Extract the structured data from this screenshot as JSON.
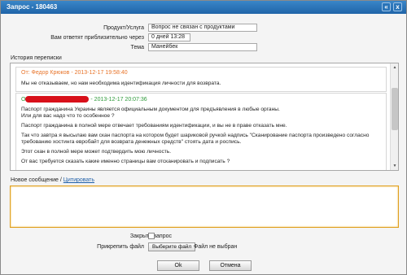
{
  "window": {
    "title": "Запрос - 180463",
    "controls": [
      "«",
      "x"
    ]
  },
  "form": {
    "product_label": "Продукт/Услуга",
    "product_value": "Вопрос не связан с продуктами",
    "eta_label": "Вам ответят приблизительно через",
    "eta_value": "0 дней 13:28",
    "subject_label": "Тема",
    "subject_value": "Манейбек"
  },
  "history": {
    "label": "История переписки",
    "messages": [
      {
        "header": "От: Федор Крюков - 2013-12-17 19:58:40",
        "header_color": "#e8742a",
        "lines": [
          "Мы не отказываем, но нам необходима идентификация личности для возврата."
        ]
      },
      {
        "header_prefix": "О",
        "header_suffix": "- 2013-12-17 20:07:36",
        "header_color": "#2e9a3a",
        "lines": [
          "Паспорт гражданина Украины является официальным документом для предъявления в любые органы.",
          "Или для вас надо что то особенное ?",
          "Паспорт гражданина в полной мере отвечает требованиям идентификации, и вы не в праве отказать мне.",
          "Так что завтра я высылаю вам скан паспорта на котором будет шариковой ручкой надпись \"Сканирование паспорта произведено согласно требованию хостинга евробайт для возврата денежных средств\" стоять дата и роспись.",
          "Этот скан в полной мере может подтвердить мою личность.",
          "От вас требуется сказать какие именно страницы вам отсканировать и подписать ?"
        ]
      }
    ]
  },
  "compose": {
    "label": "Новое сообщение / ",
    "quote_link": "Цитировать",
    "value": ""
  },
  "options": {
    "close_label": "Закрыть запрос",
    "attach_label": "Прикрепить файл",
    "file_button": "Выберите файл",
    "file_status": "Файл не выбран"
  },
  "actions": {
    "ok": "Ok",
    "cancel": "Отмена"
  },
  "colors": {
    "titlebar": "#1f64a8",
    "compose_border": "#e0a020",
    "redaction": "#d8101a"
  }
}
